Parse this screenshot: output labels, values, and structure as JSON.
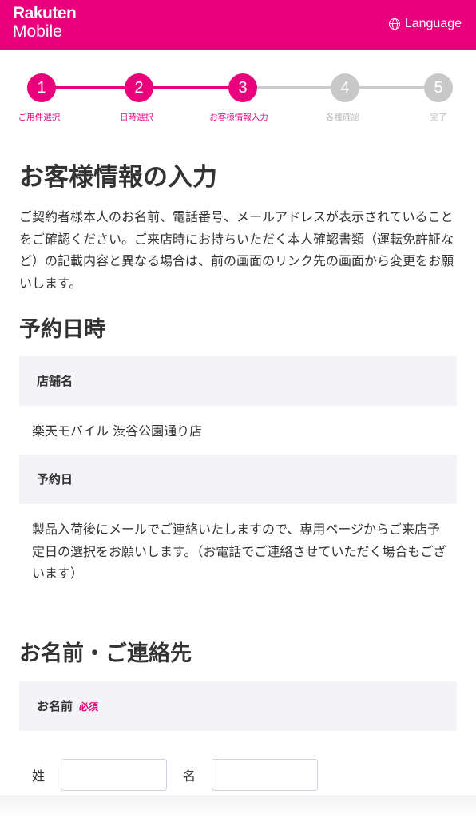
{
  "header": {
    "logo_top": "Rakuten",
    "logo_bottom": "Mobile",
    "language_label": "Language"
  },
  "stepper": {
    "current_step": 3,
    "steps": [
      {
        "number": "1",
        "label": "ご用件選択"
      },
      {
        "number": "2",
        "label": "日時選択"
      },
      {
        "number": "3",
        "label": "お客様情報入力"
      },
      {
        "number": "4",
        "label": "各種確認"
      },
      {
        "number": "5",
        "label": "完了"
      }
    ]
  },
  "page": {
    "title": "お客様情報の入力",
    "intro": "ご契約者様本人のお名前、電話番号、メールアドレスが表示されていることをご確認ください。ご来店時にお持ちいただく本人確認書類（運転免許証など）の記載内容と異なる場合は、前の画面のリンク先の画面から変更をお願いします。"
  },
  "reservation": {
    "heading": "予約日時",
    "store_label": "店舗名",
    "store_value": "楽天モバイル 渋谷公園通り店",
    "date_label": "予約日",
    "date_value": "製品入荷後にメールでご連絡いたしますので、専用ページからご来店予定日の選択をお願いします。（お電話でご連絡させていただく場合もございます）"
  },
  "contact": {
    "heading": "お名前・ご連絡先",
    "name_label": "お名前",
    "required_label": "必須",
    "last_name_label": "姓",
    "last_name_value": "",
    "first_name_label": "名",
    "first_name_value": ""
  },
  "colors": {
    "brand": "#e8007d",
    "inactive": "#cccccc",
    "field_bg": "#f4f4f8"
  }
}
